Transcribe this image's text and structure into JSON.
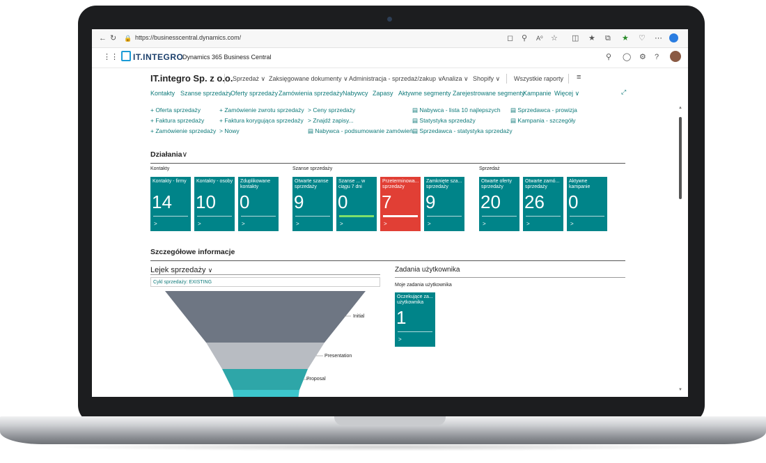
{
  "browser": {
    "url": "https://businesscentral.dynamics.com/",
    "nav_icons": [
      "back-icon",
      "refresh-icon",
      "lock-icon"
    ],
    "toolbar_icons": [
      "cast-icon",
      "zoom-icon",
      "read-aloud-icon",
      "favorite-icon",
      "split-icon",
      "favorites-icon",
      "collections-icon",
      "extension-icon",
      "heart-icon",
      "more-icon",
      "copilot-icon"
    ]
  },
  "app": {
    "logo_text": "IT.INTEGRO",
    "product_name": "Dynamics 365 Business Central"
  },
  "header": {
    "company": "IT.integro Sp. z o.o.",
    "menus": [
      "Sprzedaż",
      "Zaksięgowane dokumenty",
      "Administracja - sprzedaż/zakup",
      "Analiza",
      "Shopify"
    ],
    "all_reports": "Wszystkie raporty",
    "hamburger": "≡"
  },
  "nav": {
    "links": [
      "Kontakty",
      "Szanse sprzedaży",
      "Oferty sprzedaży",
      "Zamówienia sprzedaży",
      "Nabywcy",
      "Zapasy",
      "Aktywne segmenty",
      "Zarejestrowane segmenty",
      "Kampanie"
    ],
    "more": "Więcej"
  },
  "actions": {
    "col1": [
      "+ Oferta sprzedaży",
      "+ Faktura sprzedaży",
      "+ Zamówienie sprzedaży"
    ],
    "col2": [
      "+ Zamówienie zwrotu sprzedaży",
      "+ Faktura korygująca sprzedaży",
      "> Nowy"
    ],
    "col3": [
      "> Ceny sprzedaży",
      "> Znajdź zapisy...",
      "Nabywca - podsumowanie zamówień"
    ],
    "col4": [
      "Nabywca - lista 10 najlepszych",
      "Statystyka sprzedaży",
      "Sprzedawca - statystyka sprzedaży"
    ],
    "col5": [
      "Sprzedawca - prowizja",
      "Kampania - szczegóły"
    ]
  },
  "activities": {
    "title": "Działania",
    "groups": [
      {
        "name": "Kontakty",
        "tiles": [
          {
            "label": "Kontakty - firmy",
            "value": "14"
          },
          {
            "label": "Kontakty - osoby",
            "value": "10"
          },
          {
            "label": "Zduplikowane kontakty",
            "value": "0"
          }
        ]
      },
      {
        "name": "Szanse sprzedaży",
        "tiles": [
          {
            "label": "Otwarte szanse sprzedaży",
            "value": "9"
          },
          {
            "label": "Szanse ... w ciągu 7 dni",
            "value": "0",
            "bar_color": "#7ee06b"
          },
          {
            "label": "Przeterminowa... sprzedaży",
            "value": "7",
            "alert": true,
            "bar_color": "#ffffff"
          },
          {
            "label": "Zamknięte sza... sprzedaży",
            "value": "9"
          }
        ]
      },
      {
        "name": "Sprzedaż",
        "tiles": [
          {
            "label": "Otwarte oferty sprzedaży",
            "value": "20"
          },
          {
            "label": "Otwarte zamó... sprzedaży",
            "value": "26"
          },
          {
            "label": "Aktywne kampanie",
            "value": "0"
          }
        ]
      }
    ],
    "chevron": ">"
  },
  "details": {
    "title": "Szczegółowe informacje",
    "funnel": {
      "title": "Lejek sprzedaży",
      "cycle": "Cykl sprzedaży: EXISTING",
      "stages": [
        "Initial",
        "Presentation",
        "Proposal"
      ],
      "colors": [
        "#6e7683",
        "#b8bcc2",
        "#2ea6a8",
        "#3cc6cc"
      ]
    },
    "tasks": {
      "title": "Zadania użytkownika",
      "subtitle": "Moje zadania użytkownika",
      "tile": {
        "label": "Oczekujące za... użytkownika",
        "value": "1"
      }
    }
  },
  "colors": {
    "tile": "#008489",
    "alert": "#e13f35",
    "link": "#0f7a7a"
  }
}
